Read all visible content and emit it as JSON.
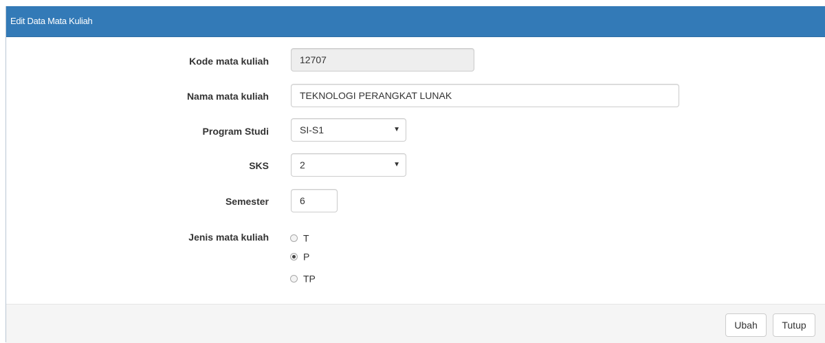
{
  "modal": {
    "title": "Edit Data Mata Kuliah"
  },
  "form": {
    "kode": {
      "label": "Kode mata kuliah",
      "value": "12707"
    },
    "nama": {
      "label": "Nama mata kuliah",
      "value": "TEKNOLOGI PERANGKAT LUNAK"
    },
    "prodi": {
      "label": "Program Studi",
      "value": "SI-S1"
    },
    "sks": {
      "label": "SKS",
      "value": "2"
    },
    "semester": {
      "label": "Semester",
      "value": "6"
    },
    "jenis": {
      "label": "Jenis mata kuliah",
      "options": [
        {
          "label": "T",
          "checked": false
        },
        {
          "label": "P",
          "checked": true
        },
        {
          "label": "TP",
          "checked": false
        }
      ]
    }
  },
  "footer": {
    "ubah_label": "Ubah",
    "tutup_label": "Tutup"
  },
  "colors": {
    "header": "#337ab7",
    "footer": "#f5f5f5",
    "readonly_field": "#eeeeee"
  }
}
